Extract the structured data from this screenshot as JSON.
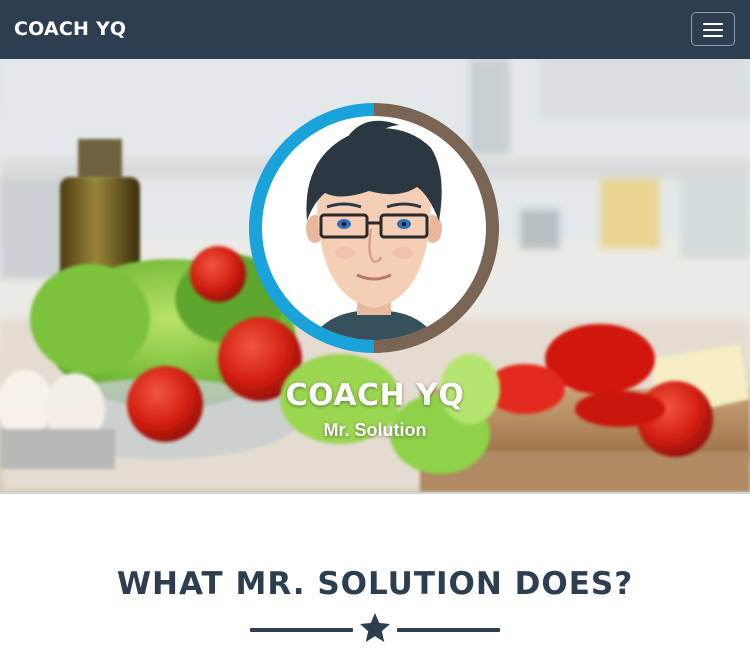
{
  "navbar": {
    "brand": "COACH YQ",
    "menu_icon": "hamburger-menu-icon"
  },
  "hero": {
    "title": "COACH YQ",
    "subtitle": "Mr. Solution",
    "avatar": "cartoon-avatar-with-glasses"
  },
  "section": {
    "title": "WHAT MR. SOLUTION DOES?",
    "divider_icon": "star-icon"
  },
  "colors": {
    "navbar_bg": "#2c3e50",
    "heading": "#2c3e50",
    "avatar_ring_blue": "#1aa3db",
    "avatar_ring_brown": "#7a6555"
  }
}
